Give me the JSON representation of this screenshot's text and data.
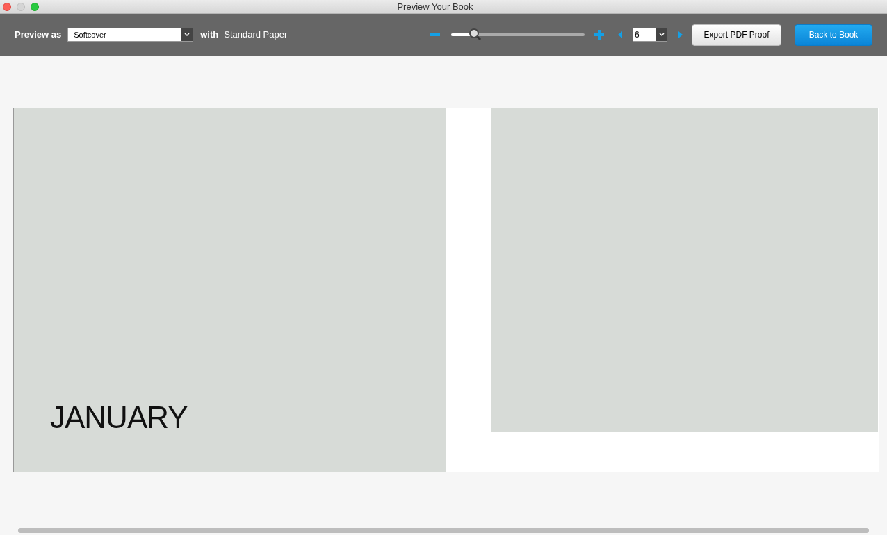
{
  "window": {
    "title": "Preview Your Book"
  },
  "toolbar": {
    "preview_label": "Preview as",
    "cover_select": {
      "value": "Softcover"
    },
    "with_label": "with",
    "paper": "Standard Paper",
    "zoom": {
      "level": 0.17
    },
    "page_select": {
      "value": "6"
    },
    "buttons": [
      {
        "label": "Export PDF Proof",
        "kind": "secondary"
      },
      {
        "label": "Back to Book",
        "kind": "primary"
      }
    ]
  },
  "spread": {
    "left_page": {
      "heading": "JANUARY"
    }
  }
}
